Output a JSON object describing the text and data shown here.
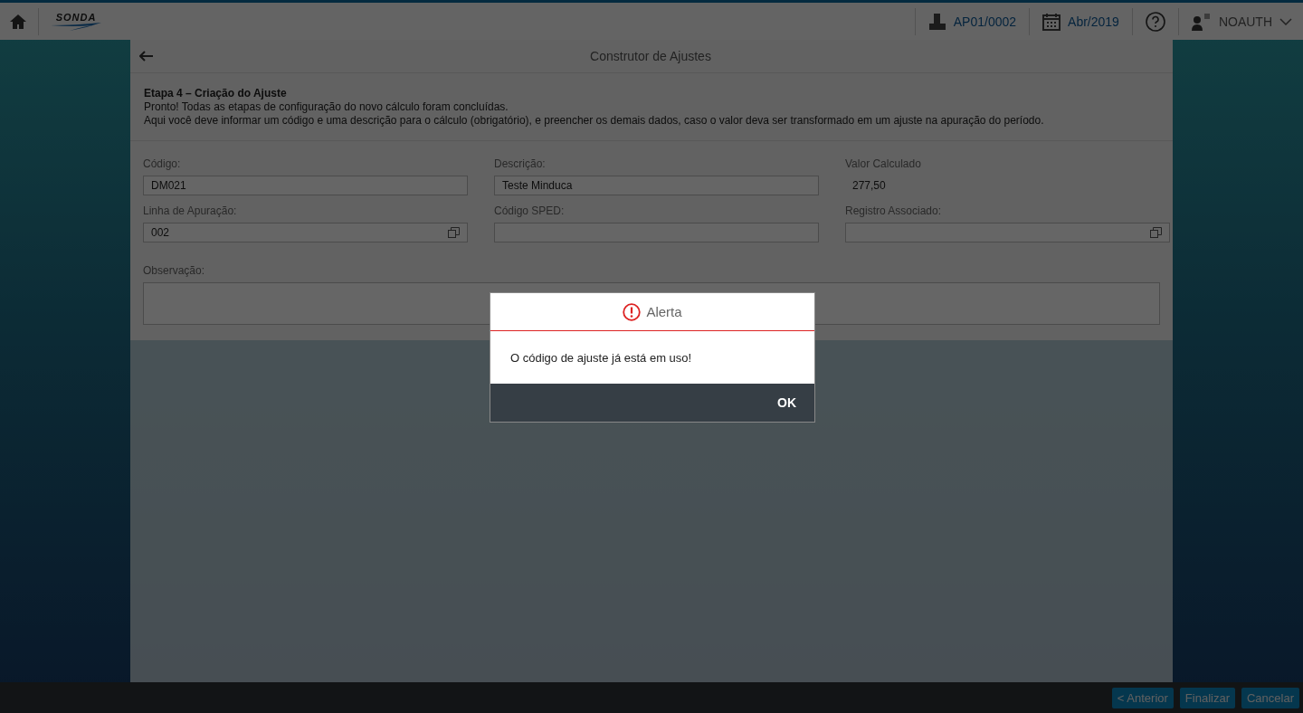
{
  "header": {
    "logo": "SONDA",
    "company": "AP01/0002",
    "period": "Abr/2019",
    "user": "NOAUTH"
  },
  "panel": {
    "title": "Construtor de Ajustes",
    "intro": {
      "heading": "Etapa 4 – Criação do Ajuste",
      "lines": [
        "Pronto! Todas as etapas de configuração do novo cálculo foram concluídas.",
        "Aqui você deve informar um código e uma descrição para o cálculo (obrigatório), e preencher os demais dados, caso o valor deva ser transformado em um ajuste na apuração do período."
      ]
    },
    "fields": [
      {
        "kind": "input",
        "label": "Código:",
        "value": "DM021"
      },
      {
        "kind": "input",
        "label": "Descrição:",
        "value": "Teste Minduca"
      },
      {
        "kind": "readonly",
        "label": "Valor Calculado",
        "value": "277,50"
      },
      {
        "kind": "lookup",
        "label": "Linha de Apuração:",
        "value": "002"
      },
      {
        "kind": "input",
        "label": "Código SPED:"
      },
      {
        "kind": "lookup",
        "label": "Registro Associado:"
      }
    ],
    "observation": {
      "label": "Observação:"
    },
    "footer_buttons": [
      "< Anterior",
      "Finalizar",
      "Cancelar"
    ]
  },
  "dialog": {
    "title": "Alerta",
    "message": "O código de ajuste já está em uso!",
    "button": "OK"
  }
}
